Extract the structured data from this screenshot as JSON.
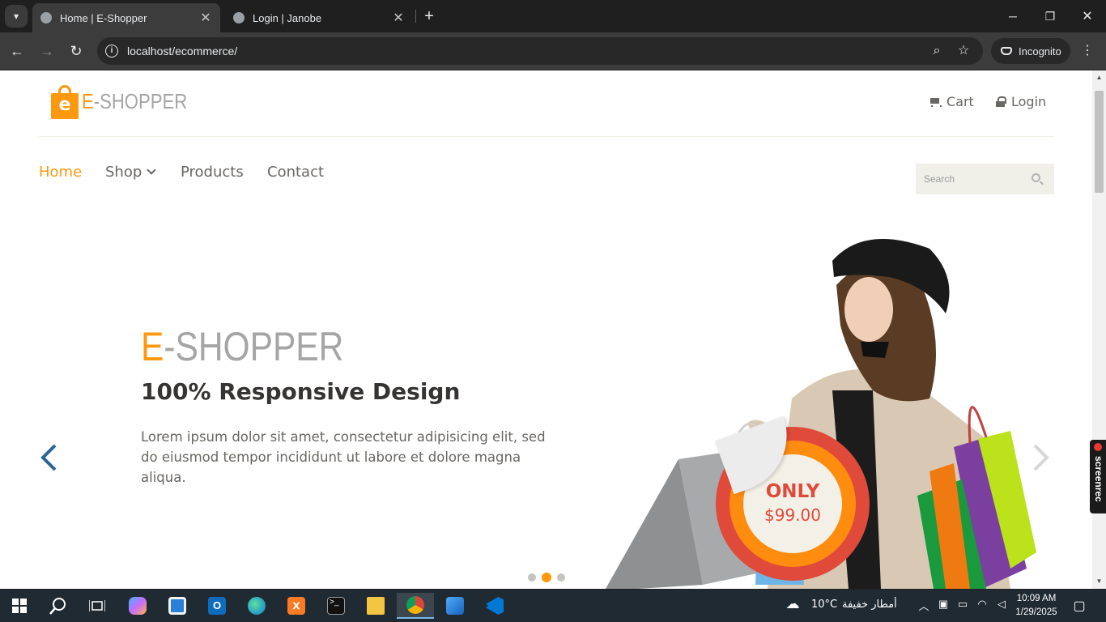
{
  "browser": {
    "tabs": [
      {
        "title": "Home | E-Shopper",
        "active": true
      },
      {
        "title": "Login | Janobe",
        "active": false
      }
    ],
    "url": "localhost/ecommerce/",
    "incognito_label": "Incognito",
    "icons": {
      "back": "arrow-left-icon",
      "forward": "arrow-right-icon",
      "reload": "reload-icon",
      "zoom": "zoom-icon",
      "bookmark": "star-icon",
      "menu": "kebab-menu-icon"
    }
  },
  "site": {
    "logo": {
      "e": "E",
      "rest": "-SHOPPER"
    },
    "header_links": [
      {
        "label": "Cart",
        "icon": "shopping-cart-icon"
      },
      {
        "label": "Login",
        "icon": "lock-icon"
      }
    ],
    "nav": [
      {
        "label": "Home",
        "active": true
      },
      {
        "label": "Shop",
        "has_dropdown": true
      },
      {
        "label": "Products"
      },
      {
        "label": "Contact"
      }
    ],
    "search": {
      "placeholder": "Search"
    },
    "accent_color": "#fe980f"
  },
  "slider": {
    "brand": {
      "e": "E",
      "rest": "-SHOPPER"
    },
    "title": "100% Responsive Design",
    "text": "Lorem ipsum dolor sit amet, consectetur adipisicing elit, sed do eiusmod tempor incididunt ut labore et dolore magna aliqua.",
    "badge": {
      "line1": "ONLY",
      "line2": "$99.00"
    },
    "indicators": 3,
    "active_indicator": 2
  },
  "overlay": {
    "screenrec_label": "screenrec"
  },
  "taskbar": {
    "weather_temp": "10°C",
    "weather_text": "أمطار خفيفة",
    "time": "10:09 AM",
    "date": "1/29/2025"
  }
}
